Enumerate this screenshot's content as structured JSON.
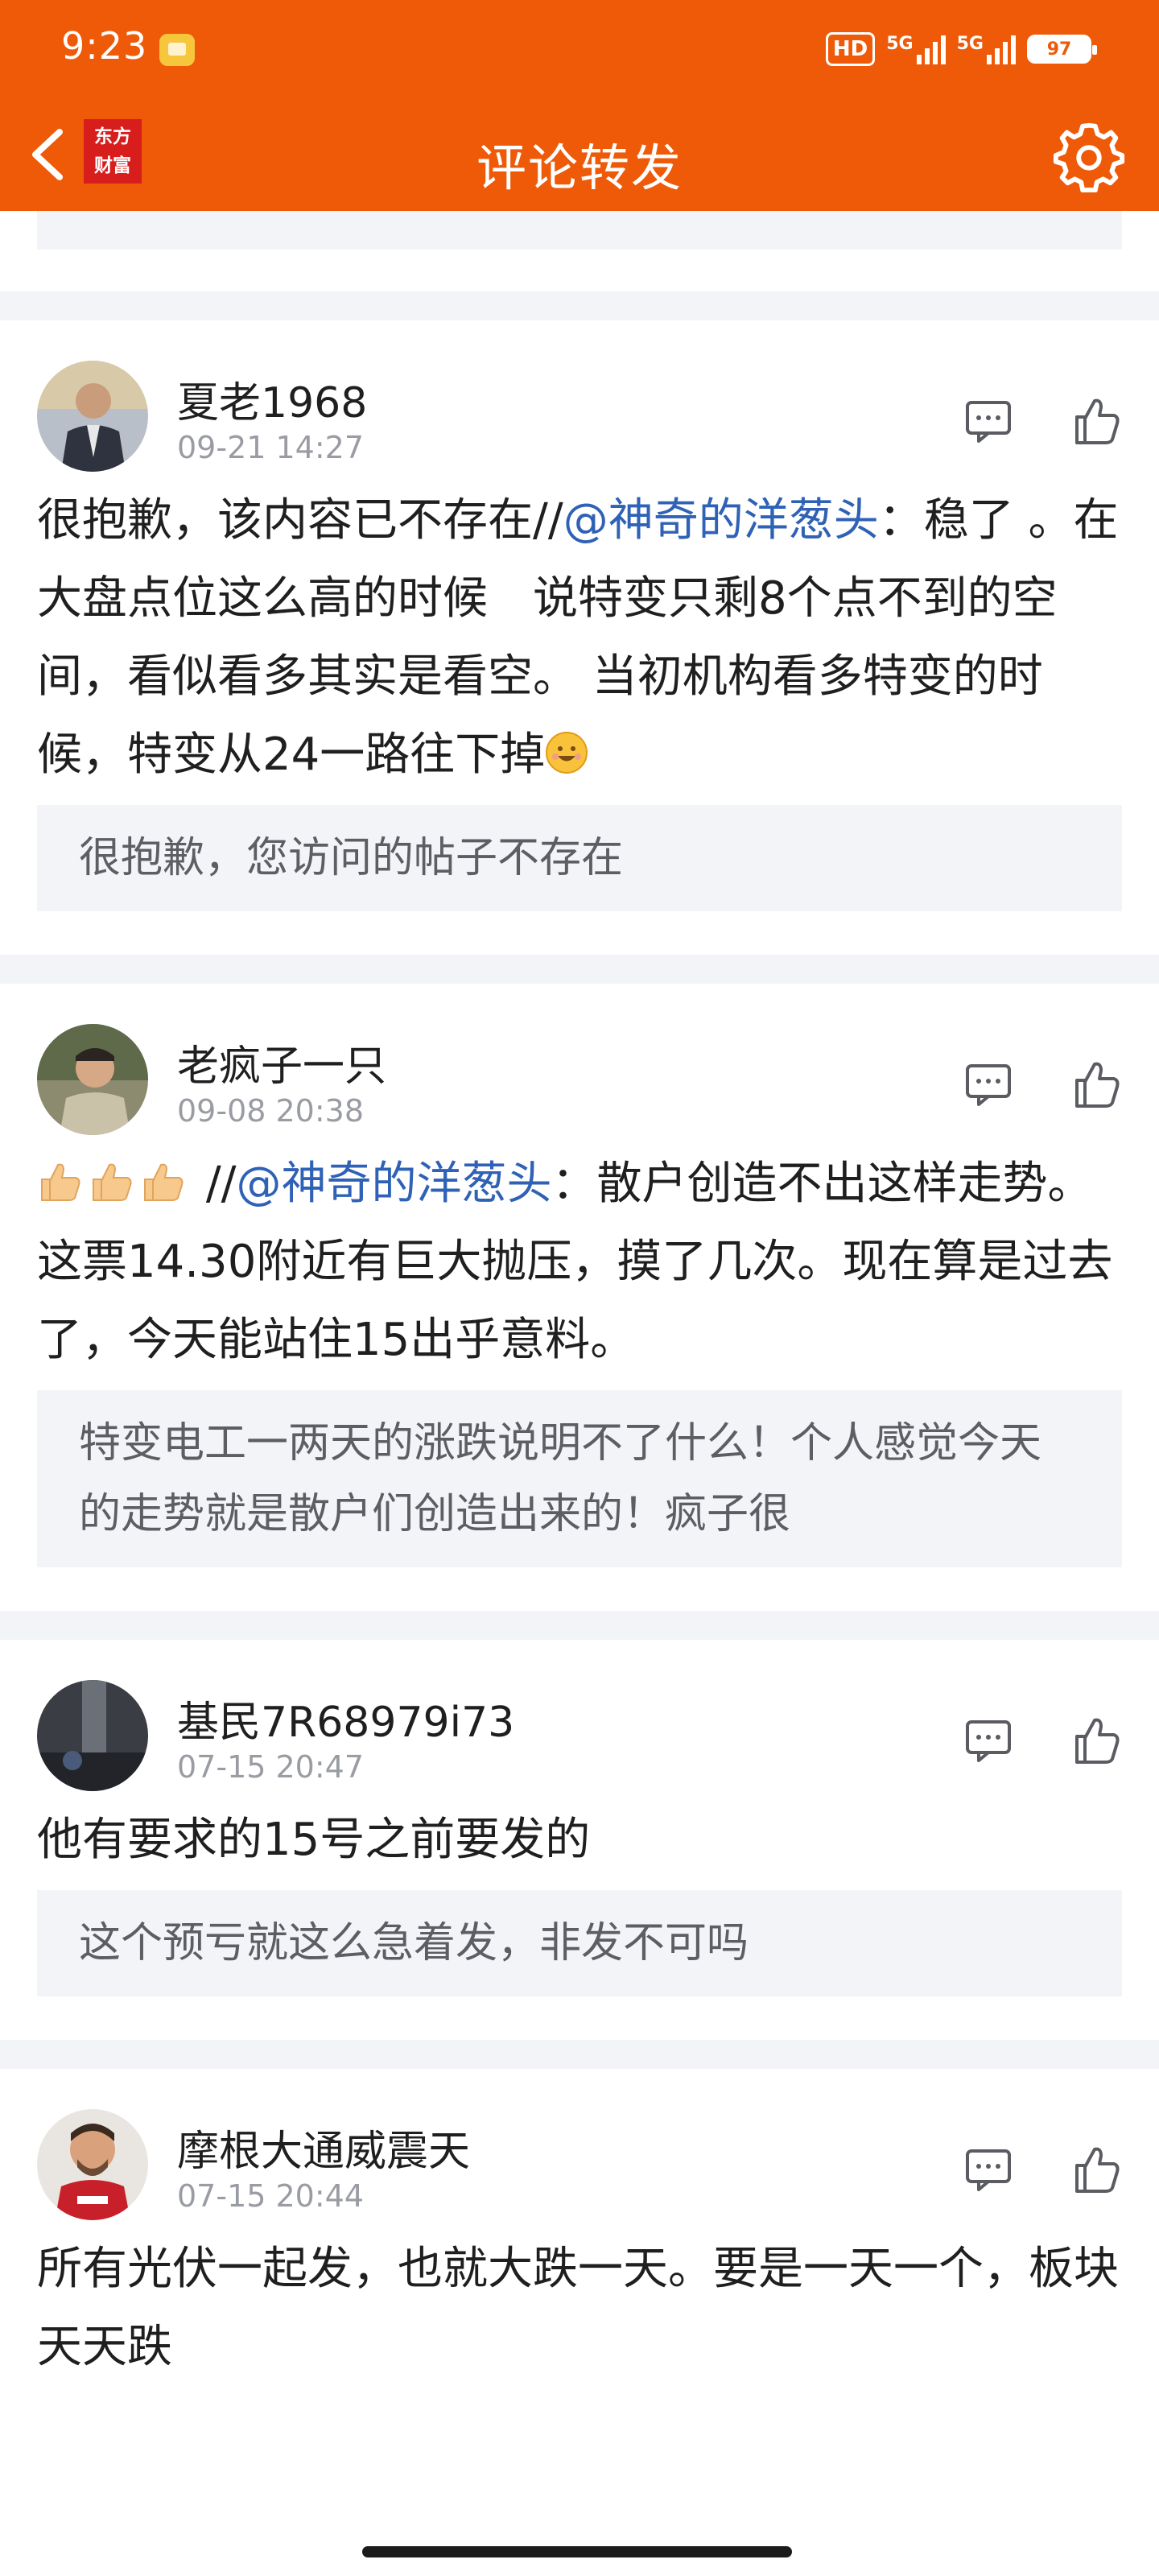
{
  "status_bar": {
    "time": "9:23",
    "hd": "HD",
    "net1": "5G",
    "net2": "5G",
    "battery": "97"
  },
  "navbar": {
    "logo_line1": "东方",
    "logo_line2": "财富",
    "title": "评论转发"
  },
  "colors": {
    "accent": "#ee5a08",
    "mention": "#2f62b6",
    "quote_bg": "#f3f4f7"
  },
  "posts": [
    {
      "user": "夏老1968",
      "time": "09-21 14:27",
      "text_before": "很抱歉，该内容已不存在//",
      "mention": "@神奇的洋葱头",
      "text_after": "：稳了 。在大盘点位这么高的时候　说特变只剩8个点不到的空间，看似看多其实是看空。 当初机构看多特变的时候，特变从24一路往下掉",
      "emoji": "smile",
      "quote": "很抱歉，您访问的帖子不存在"
    },
    {
      "user": "老疯子一只",
      "time": "09-08 20:38",
      "text_before": "//",
      "mention": "@神奇的洋葱头",
      "text_after": "：散户创造不出这样走势。这票14.30附近有巨大抛压，摸了几次。现在算是过去了，今天能站住15出乎意料。",
      "emoji": "thumbs-up x3",
      "quote": "特变电工一两天的涨跌说明不了什么！个人感觉今天的走势就是散户们创造出来的！疯子很"
    },
    {
      "user": "基民7R68979i73",
      "time": "07-15 20:47",
      "text": "他有要求的15号之前要发的",
      "quote": "这个预亏就这么急着发，非发不可吗"
    },
    {
      "user": "摩根大通威震天",
      "time": "07-15 20:44",
      "text": "所有光伏一起发，也就大跌一天。要是一天一个，板块天天跌"
    }
  ]
}
